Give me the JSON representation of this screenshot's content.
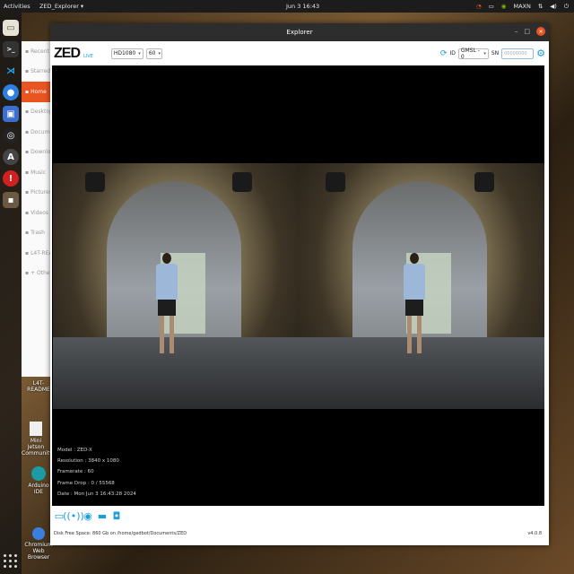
{
  "topbar": {
    "activities": "Activities",
    "app_name": "ZED_Explorer",
    "clock": "Jun 3  16:43",
    "user": "MAXN"
  },
  "files_sidebar": {
    "items": [
      {
        "label": "Recent",
        "icon": "clock-icon"
      },
      {
        "label": "Starred",
        "icon": "star-icon"
      },
      {
        "label": "Home",
        "icon": "home-icon",
        "active": true
      },
      {
        "label": "Desktop",
        "icon": "desktop-folder-icon"
      },
      {
        "label": "Documents",
        "icon": "document-folder-icon"
      },
      {
        "label": "Downloads",
        "icon": "download-icon"
      },
      {
        "label": "Music",
        "icon": "music-icon"
      },
      {
        "label": "Pictures",
        "icon": "picture-icon"
      },
      {
        "label": "Videos",
        "icon": "video-icon"
      },
      {
        "label": "Trash",
        "icon": "trash-icon"
      },
      {
        "label": "L4T-README",
        "icon": "drive-icon"
      },
      {
        "label": "+ Other Locations",
        "icon": "plus-icon"
      }
    ]
  },
  "desktop": {
    "readme": "L4T-README",
    "doc_label": "Mini Jetson Community",
    "arduino": "Arduino IDE",
    "chromium": "Chromium Web Browser"
  },
  "window": {
    "title": "Explorer"
  },
  "toolbar": {
    "logo": "ZED",
    "live": "LIVE",
    "resolution": "HD1080",
    "fps": "60",
    "id_label": "ID",
    "id_value": "GMSL - 0",
    "sn_label": "SN",
    "sn_placeholder": "00000000"
  },
  "camera_info": {
    "model": "Model : ZED-X",
    "resolution": "Resolution : 3840 x 1080",
    "framerate": "Framerate : 60",
    "frame_drop": "Frame Drop : 0 / 55568",
    "date": "Date : Mon Jun 3 16:43:28 2024"
  },
  "status": {
    "disk": "Disk Free Space: 860 Gb  on /home/gedbot/Documents/ZED",
    "version": "v4.0.8"
  },
  "colors": {
    "accent": "#1a9fd8",
    "ubuntu_orange": "#e95420"
  }
}
